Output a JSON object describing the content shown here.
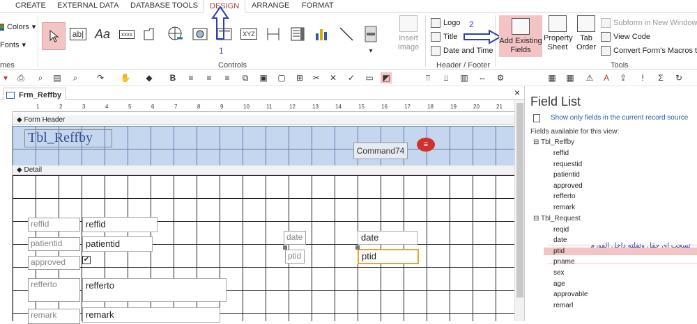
{
  "ribbon_tabs": [
    "CREATE",
    "EXTERNAL DATA",
    "DATABASE TOOLS",
    "DESIGN",
    "ARRANGE",
    "FORMAT"
  ],
  "themes": {
    "colors_label": "Colors",
    "fonts_label": "Fonts",
    "group_label": "mes"
  },
  "controls": {
    "group_label": "Controls",
    "textbox_icon": "ab|",
    "label_icon": "Aa",
    "button_icon": "xxxx",
    "xyz_icon": "XYZ",
    "insert_image_label": "Insert Image",
    "annotation_1": "1"
  },
  "header_footer": {
    "group_label": "Header / Footer",
    "logo": "Logo",
    "title": "Title",
    "date_time": "Date and Time"
  },
  "tools": {
    "group_label": "Tools",
    "add_existing_fields": "Add Existing Fields",
    "property_sheet": "Property Sheet",
    "tab_order": "Tab Order",
    "subform": "Subform in New Window",
    "view_code": "View Code",
    "convert_macros": "Convert Form's Macros to",
    "annotation_2": "2"
  },
  "document": {
    "tab_name": "Frm_Reffby",
    "close": "×"
  },
  "ruler_numbers": [
    "1",
    "2",
    "3",
    "4",
    "5",
    "6",
    "7",
    "8",
    "9",
    "10",
    "11",
    "12",
    "13",
    "14",
    "15",
    "16",
    "17",
    "18",
    "19",
    "20",
    "21"
  ],
  "form_header": {
    "section_label": "Form Header",
    "title_label": "Tbl_Reffby",
    "command_button": "Command74"
  },
  "detail": {
    "section_label": "Detail",
    "fields": [
      {
        "label": "reffid",
        "control": "reffid"
      },
      {
        "label": "patientid",
        "control": "patientid"
      },
      {
        "label": "approved",
        "control": "✔"
      },
      {
        "label": "refferto",
        "control": "refferto"
      },
      {
        "label": "remark",
        "control": "remark"
      },
      {
        "label": "date",
        "control": "date"
      },
      {
        "label": "ptid",
        "control": "ptid"
      }
    ]
  },
  "field_list": {
    "title": "Field List",
    "show_only": "Show only fields in the current record source",
    "available": "Fields available for this view:",
    "tables": [
      {
        "name": "Tbl_Reffby",
        "fields": [
          "reffid",
          "requestid",
          "patientid",
          "approved",
          "refferto",
          "remark"
        ]
      },
      {
        "name": "Tbl_Request",
        "fields": [
          "reqid",
          "date",
          "ptid",
          "pname",
          "sex",
          "age",
          "approvable",
          "remarl"
        ]
      }
    ],
    "arabic_note": "تسحب اي حقل وتفلته داخل الفورم"
  },
  "colors": {
    "accent": "#a4373a",
    "highlight": "#f4c4c4",
    "header_section": "#c5d7ef",
    "annotation_arrow": "#2b3fb8",
    "selected_outline": "#f0a030"
  }
}
